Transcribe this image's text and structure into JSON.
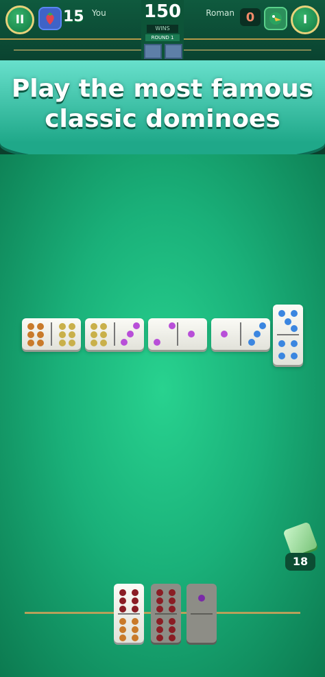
{
  "header": {
    "pause_icon": "pause-icon",
    "info_icon": "info-icon",
    "player_you": {
      "score": "15",
      "name": "You"
    },
    "player_roman": {
      "score": "0",
      "name": "Roman"
    },
    "target_score": "150",
    "target_sub": "WINS",
    "round_label": "ROUND 1"
  },
  "banner": {
    "line1": "Play the most famous",
    "line2": "classic dominoes"
  },
  "board": {
    "tiles": [
      {
        "a": 6,
        "b": 6
      },
      {
        "a": 6,
        "b": 3
      },
      {
        "a": 3,
        "b": 3
      },
      {
        "a": 3,
        "b": 4
      },
      {
        "a": 4,
        "b": 4
      }
    ]
  },
  "hand": {
    "tiles": [
      {
        "a": 6,
        "b": 6
      },
      {
        "a": 6,
        "b": 6
      },
      {
        "a": 1,
        "b": 0
      }
    ]
  },
  "boneyard": {
    "count": "18"
  },
  "colors": {
    "table": "#1ab079",
    "banner": "#68e0cc",
    "gold": "#e8d27a"
  }
}
